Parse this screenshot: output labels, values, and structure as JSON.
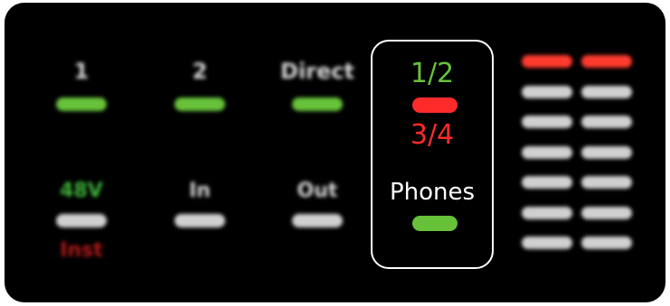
{
  "inputs": {
    "channel_1": {
      "label": "1",
      "led_color": "#67c23a"
    },
    "channel_2": {
      "label": "2",
      "led_color": "#67c23a"
    },
    "direct": {
      "label": "Direct",
      "led_color": "#67c23a"
    }
  },
  "lower": {
    "phantom_label": "48V",
    "inst_label": "Inst",
    "in_label": "In",
    "out_label": "Out"
  },
  "selector": {
    "option_12": "1/2",
    "option_34": "3/4",
    "phones": "Phones"
  },
  "meters": {
    "left": [
      "#ff3b2f",
      "#d0d0d0",
      "#d0d0d0",
      "#d0d0d0",
      "#d0d0d0",
      "#d0d0d0",
      "#d0d0d0"
    ],
    "right": [
      "#ff3b2f",
      "#d0d0d0",
      "#d0d0d0",
      "#d0d0d0",
      "#d0d0d0",
      "#d0d0d0",
      "#d0d0d0"
    ]
  },
  "colors": {
    "green": "#67c23a",
    "red": "#ff2a2a",
    "white_led": "#d0d0d0",
    "background": "#000000"
  }
}
